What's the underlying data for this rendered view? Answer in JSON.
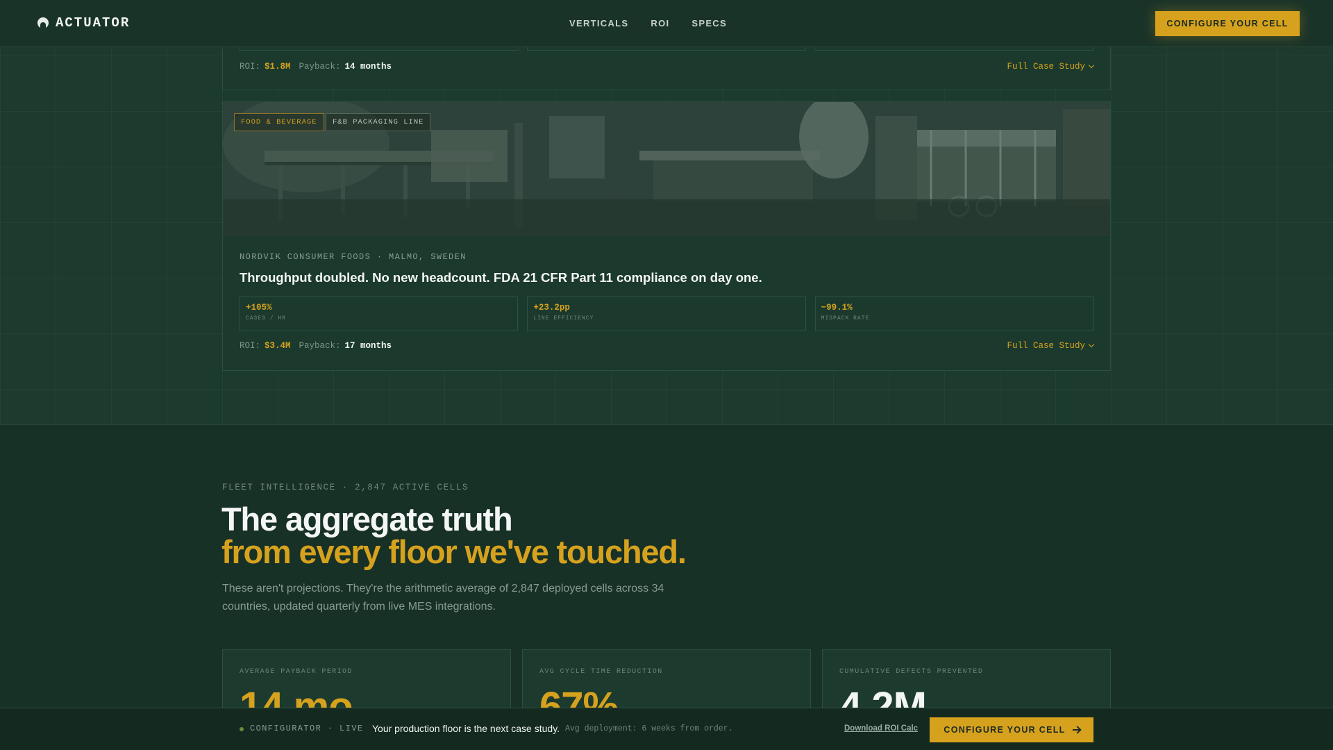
{
  "nav": {
    "brand": "ACTUATOR",
    "logo_icon": "actuator-logo-icon",
    "links": [
      "VERTICALS",
      "ROI",
      "SPECS"
    ],
    "cta": "CONFIGURE YOUR CELL"
  },
  "case_prev": {
    "roi_label": "ROI:",
    "roi_value": "$1.8M",
    "payback_label": "Payback:",
    "payback_value": "14 months",
    "link": "Full Case Study"
  },
  "case_main": {
    "tags": [
      "FOOD & BEVERAGE",
      "F&B PACKAGING LINE"
    ],
    "company": "NORDVIK CONSUMER FOODS · MALMO, SWEDEN",
    "headline": "Throughput doubled. No new headcount. FDA 21 CFR Part 11 compliance on day one.",
    "metrics": [
      {
        "value": "+105%",
        "label": "CASES / HR"
      },
      {
        "value": "+23.2pp",
        "label": "LINE EFFICIENCY"
      },
      {
        "value": "−99.1%",
        "label": "MISPACK RATE"
      }
    ],
    "roi_label": "ROI:",
    "roi_value": "$3.4M",
    "payback_label": "Payback:",
    "payback_value": "17 months",
    "link": "Full Case Study"
  },
  "fleet": {
    "eyebrow": "FLEET INTELLIGENCE · 2,847 ACTIVE CELLS",
    "heading_line1": "The aggregate truth",
    "heading_line2": "from every floor we've touched.",
    "lede": "These aren't projections. They're the arithmetic average of 2,847 deployed cells across 34 countries, updated quarterly from live MES integrations.",
    "kpis": [
      {
        "label": "AVERAGE PAYBACK PERIOD",
        "value": "14 mo"
      },
      {
        "label": "AVG CYCLE TIME REDUCTION",
        "value": "67%"
      },
      {
        "label": "CUMULATIVE DEFECTS PREVENTED",
        "value": "4.2M"
      }
    ]
  },
  "bottombar": {
    "live_label": "CONFIGURATOR · LIVE",
    "message": "Your production floor is the next case study.",
    "sub": "Avg deployment: 6 weeks from order.",
    "link": "Download ROI Calc",
    "cta": "CONFIGURE YOUR CELL"
  },
  "colors": {
    "accent": "#d6a21e",
    "background": "#183127",
    "card": "#1b3a2d"
  }
}
